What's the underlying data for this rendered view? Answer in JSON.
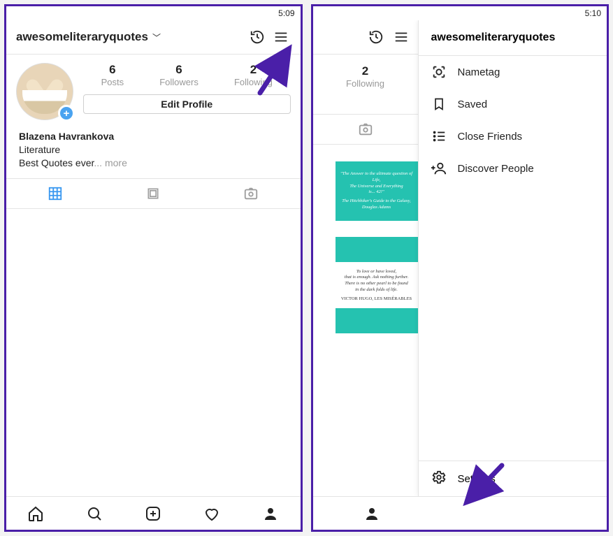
{
  "phone1": {
    "time": "5:09",
    "username": "awesomeliteraryquotes",
    "stats": {
      "posts": {
        "count": "6",
        "label": "Posts"
      },
      "followers": {
        "count": "6",
        "label": "Followers"
      },
      "following": {
        "count": "2",
        "label": "Following"
      }
    },
    "edit_profile_label": "Edit Profile",
    "bio": {
      "display_name": "Blazena  Havrankova",
      "category": "Literature",
      "line": "Best Quotes ever",
      "ellipsis": "...",
      "more": " more"
    }
  },
  "phone2": {
    "time": "5:10",
    "following": {
      "count": "2",
      "label": "Following"
    },
    "drawer": {
      "title": "awesomeliteraryquotes",
      "items": [
        {
          "id": "nametag",
          "label": "Nametag"
        },
        {
          "id": "saved",
          "label": "Saved"
        },
        {
          "id": "close-friends",
          "label": "Close Friends"
        },
        {
          "id": "discover-people",
          "label": "Discover People"
        }
      ],
      "settings_label": "Settings"
    },
    "posts": {
      "teal1_l1": "\"The Answer to the ultimate question of Life,",
      "teal1_l2": "The Universe and Everything",
      "teal1_l3": "is... 42!\"",
      "teal1_l4": "The Hitchhiker's Guide to the Galaxy,",
      "teal1_l5": "Douglas Adams",
      "white_l1": "To love or have loved,",
      "white_l2": "that is enough. Ask nothing further.",
      "white_l3": "There is no other pearl to be found",
      "white_l4": "in the dark folds of life.",
      "white_l5": "VICTOR HUGO, LES MISÉRABLES"
    }
  }
}
